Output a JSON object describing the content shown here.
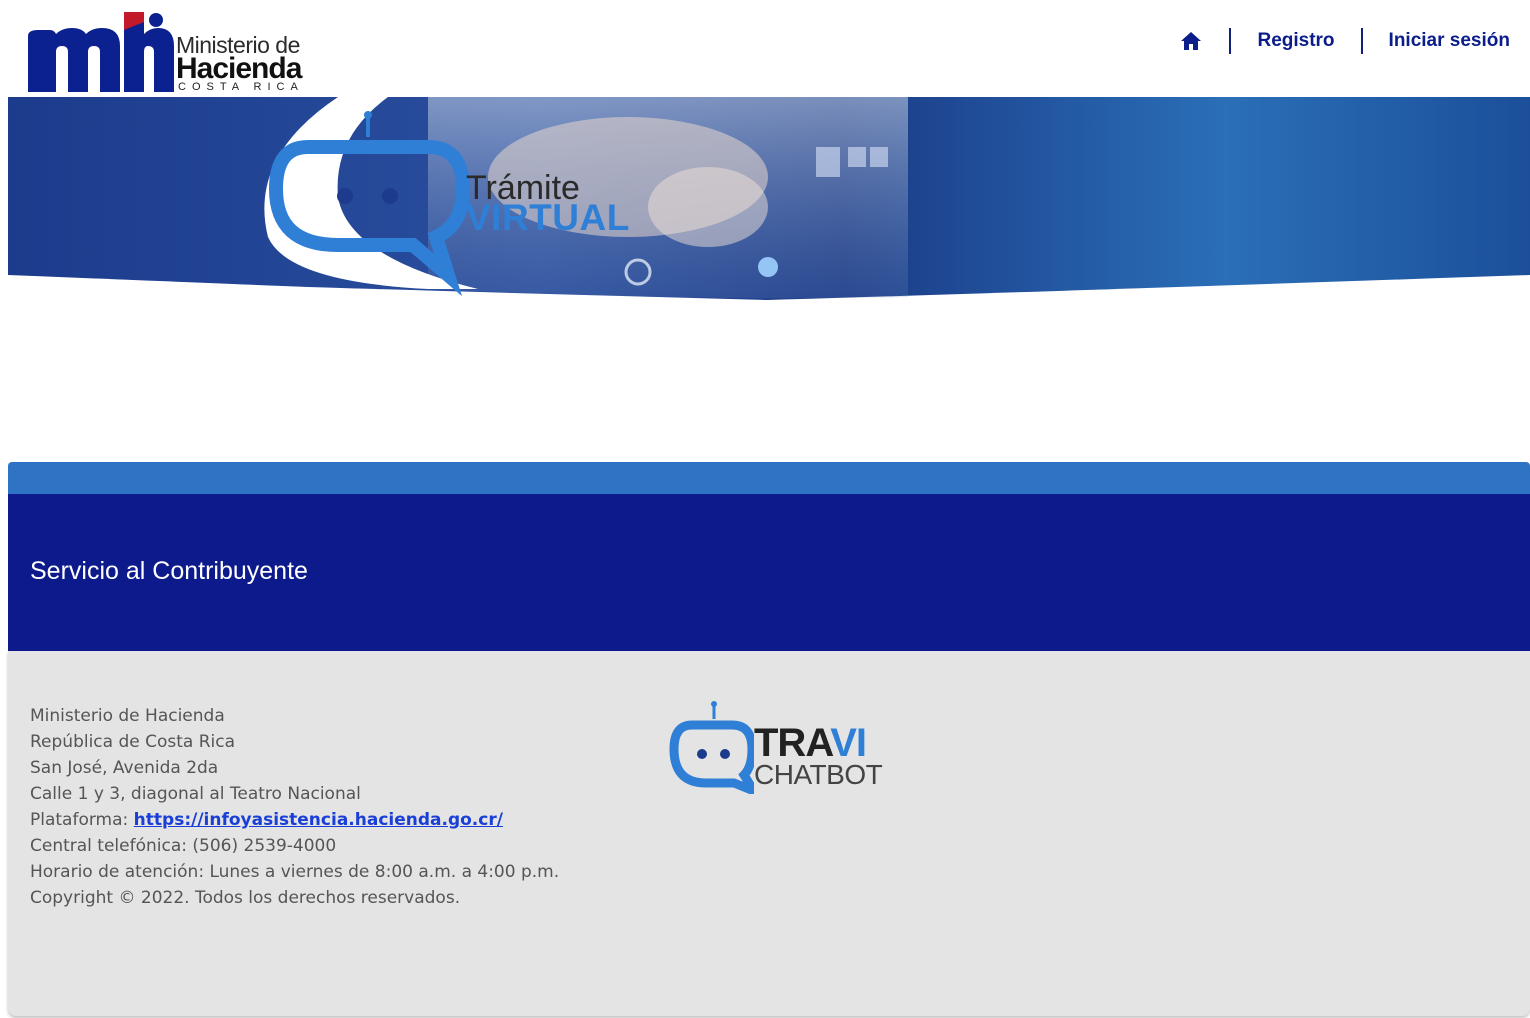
{
  "header": {
    "logo": {
      "line1": "Ministerio de",
      "line2": "Hacienda",
      "line3": "COSTA RICA"
    },
    "nav": {
      "home_icon": "home-icon",
      "registro_label": "Registro",
      "login_label": "Iniciar sesión"
    }
  },
  "banner": {
    "title_line1": "Trámite",
    "title_line2": "VIRTUAL"
  },
  "band": {
    "title": "Servicio al Contribuyente"
  },
  "footer": {
    "lines": {
      "l1": "Ministerio de Hacienda",
      "l2": "República de Costa Rica",
      "l3": "San José, Avenida 2da",
      "l4": "Calle 1 y 3, diagonal al Teatro Nacional",
      "l5_prefix": "Plataforma: ",
      "l5_link": "https://infoyasistencia.hacienda.go.cr/",
      "l6": "Central telefónica: (506) 2539-4000",
      "l7": "Horario de atención: Lunes a viernes de 8:00 a.m. a 4:00 p.m.",
      "l8": "Copyright © 2022. Todos los derechos reservados."
    },
    "chatbot": {
      "name_part1": "TRA",
      "name_part2": "VI",
      "subtitle": "CHATBOT"
    }
  },
  "colors": {
    "nav_text": "#0b1d8a",
    "band_light": "#2f73c4",
    "band_dark": "#0c1a8c",
    "accent_blue": "#2f7fd6",
    "footer_bg": "#e4e4e4",
    "link": "#1a3fd6"
  }
}
